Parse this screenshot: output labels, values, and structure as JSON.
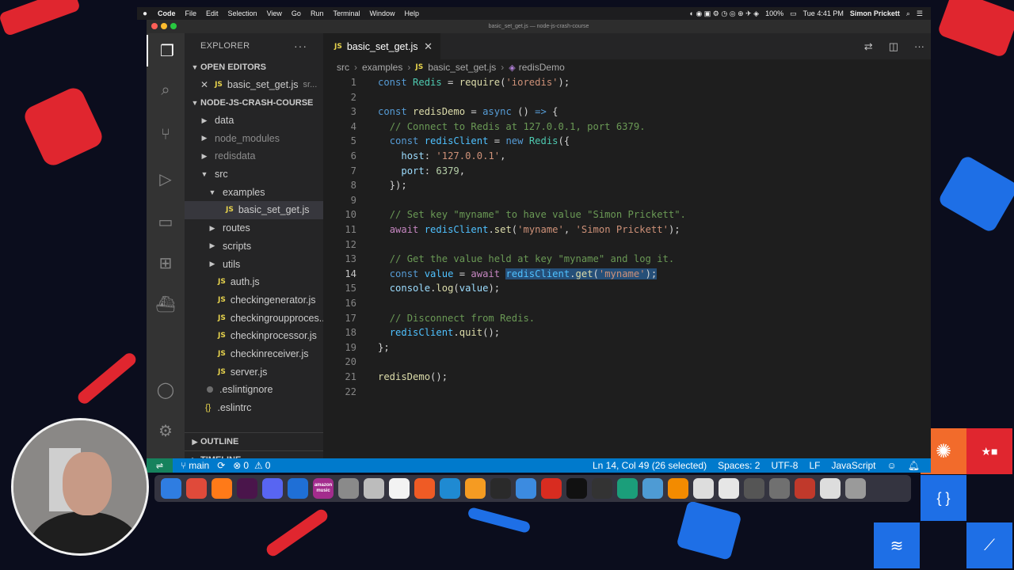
{
  "menubar": {
    "apple": "",
    "items": [
      "Code",
      "File",
      "Edit",
      "Selection",
      "View",
      "Go",
      "Run",
      "Terminal",
      "Window",
      "Help"
    ],
    "battery": "100%",
    "clock": "Tue 4:41 PM",
    "user": "Simon Prickett"
  },
  "window": {
    "title": "basic_set_get.js — node-js-crash-course"
  },
  "sidebar": {
    "title": "EXPLORER",
    "open_editors_label": "OPEN EDITORS",
    "open_editor": {
      "badge": "JS",
      "name": "basic_set_get.js",
      "path": "sr..."
    },
    "project_label": "NODE-JS-CRASH-COURSE",
    "tree": [
      {
        "name": "data",
        "kind": "folder",
        "depth": 1,
        "expanded": false,
        "dim": false
      },
      {
        "name": "node_modules",
        "kind": "folder",
        "depth": 1,
        "expanded": false,
        "dim": true
      },
      {
        "name": "redisdata",
        "kind": "folder",
        "depth": 1,
        "expanded": false,
        "dim": true
      },
      {
        "name": "src",
        "kind": "folder",
        "depth": 1,
        "expanded": true,
        "dim": false
      },
      {
        "name": "examples",
        "kind": "folder",
        "depth": 2,
        "expanded": true,
        "dim": false
      },
      {
        "name": "basic_set_get.js",
        "kind": "js",
        "depth": 3,
        "selected": true
      },
      {
        "name": "routes",
        "kind": "folder",
        "depth": 2,
        "expanded": false
      },
      {
        "name": "scripts",
        "kind": "folder",
        "depth": 2,
        "expanded": false
      },
      {
        "name": "utils",
        "kind": "folder",
        "depth": 2,
        "expanded": false
      },
      {
        "name": "auth.js",
        "kind": "js",
        "depth": 2
      },
      {
        "name": "checkingenerator.js",
        "kind": "js",
        "depth": 2
      },
      {
        "name": "checkingroupproces...",
        "kind": "js",
        "depth": 2
      },
      {
        "name": "checkinprocessor.js",
        "kind": "js",
        "depth": 2
      },
      {
        "name": "checkinreceiver.js",
        "kind": "js",
        "depth": 2
      },
      {
        "name": "server.js",
        "kind": "js",
        "depth": 2
      },
      {
        "name": ".eslintignore",
        "kind": "plain",
        "depth": 1
      },
      {
        "name": ".eslintrc",
        "kind": "json",
        "depth": 1
      }
    ],
    "outline_label": "OUTLINE",
    "timeline_label": "TIMELINE"
  },
  "editor": {
    "tab": {
      "badge": "JS",
      "name": "basic_set_get.js"
    },
    "breadcrumb": [
      "src",
      "examples",
      "basic_set_get.js",
      "redisDemo"
    ],
    "breadcrumb_badge": "JS",
    "active_line": 14,
    "lines": [
      [
        [
          "k",
          "const "
        ],
        [
          "cls",
          "Redis"
        ],
        [
          "p",
          " = "
        ],
        [
          "f",
          "require"
        ],
        [
          "p",
          "("
        ],
        [
          "s",
          "'ioredis'"
        ],
        [
          "p",
          ");"
        ]
      ],
      [],
      [
        [
          "k",
          "const "
        ],
        [
          "f",
          "redisDemo"
        ],
        [
          "p",
          " = "
        ],
        [
          "k",
          "async "
        ],
        [
          "p",
          "() "
        ],
        [
          "k",
          "=>"
        ],
        [
          "p",
          " {"
        ]
      ],
      [
        [
          "p",
          "  "
        ],
        [
          "cm",
          "// Connect to Redis at 127.0.0.1, port 6379."
        ]
      ],
      [
        [
          "p",
          "  "
        ],
        [
          "k",
          "const "
        ],
        [
          "c",
          "redisClient"
        ],
        [
          "p",
          " = "
        ],
        [
          "k",
          "new "
        ],
        [
          "cls",
          "Redis"
        ],
        [
          "p",
          "({"
        ]
      ],
      [
        [
          "p",
          "    "
        ],
        [
          "v",
          "host"
        ],
        [
          "p",
          ": "
        ],
        [
          "s",
          "'127.0.0.1'"
        ],
        [
          "p",
          ","
        ]
      ],
      [
        [
          "p",
          "    "
        ],
        [
          "v",
          "port"
        ],
        [
          "p",
          ": "
        ],
        [
          "n",
          "6379"
        ],
        [
          "p",
          ","
        ]
      ],
      [
        [
          "p",
          "  });"
        ]
      ],
      [],
      [
        [
          "p",
          "  "
        ],
        [
          "cm",
          "// Set key \"myname\" to have value \"Simon Prickett\"."
        ]
      ],
      [
        [
          "p",
          "  "
        ],
        [
          "kw2",
          "await "
        ],
        [
          "c",
          "redisClient"
        ],
        [
          "p",
          "."
        ],
        [
          "f",
          "set"
        ],
        [
          "p",
          "("
        ],
        [
          "s",
          "'myname'"
        ],
        [
          "p",
          ", "
        ],
        [
          "s",
          "'Simon Prickett'"
        ],
        [
          "p",
          ");"
        ]
      ],
      [],
      [
        [
          "p",
          "  "
        ],
        [
          "cm",
          "// Get the value held at key \"myname\" and log it."
        ]
      ],
      [
        [
          "p",
          "  "
        ],
        [
          "k",
          "const "
        ],
        [
          "c",
          "value"
        ],
        [
          "p",
          " = "
        ],
        [
          "kw2",
          "await "
        ],
        [
          "hl-c",
          "redisClient"
        ],
        [
          "hl-p",
          "."
        ],
        [
          "hl-f",
          "get"
        ],
        [
          "hl-p",
          "("
        ],
        [
          "hl-s",
          "'myname'"
        ],
        [
          "hl-p",
          ");"
        ]
      ],
      [
        [
          "p",
          "  "
        ],
        [
          "v",
          "console"
        ],
        [
          "p",
          "."
        ],
        [
          "f",
          "log"
        ],
        [
          "p",
          "("
        ],
        [
          "v",
          "value"
        ],
        [
          "p",
          ");"
        ]
      ],
      [],
      [
        [
          "p",
          "  "
        ],
        [
          "cm",
          "// Disconnect from Redis."
        ]
      ],
      [
        [
          "p",
          "  "
        ],
        [
          "c",
          "redisClient"
        ],
        [
          "p",
          "."
        ],
        [
          "f",
          "quit"
        ],
        [
          "p",
          "();"
        ]
      ],
      [
        [
          "p",
          "};"
        ]
      ],
      [],
      [
        [
          "f",
          "redisDemo"
        ],
        [
          "p",
          "();"
        ]
      ],
      []
    ]
  },
  "statusbar": {
    "branch": "main",
    "errors": "0",
    "warnings": "0",
    "position": "Ln 14, Col 49 (26 selected)",
    "spaces": "Spaces: 2",
    "encoding": "UTF-8",
    "eol": "LF",
    "language": "JavaScript"
  },
  "dock": {
    "apps": [
      {
        "icon": "finder-icon",
        "color": "#2f7de1"
      },
      {
        "icon": "chrome-icon",
        "color": "#e04a3a"
      },
      {
        "icon": "firefox-icon",
        "color": "#ff7a18"
      },
      {
        "icon": "slack-icon",
        "color": "#4a154b"
      },
      {
        "icon": "discord-icon",
        "color": "#5865f2"
      },
      {
        "icon": "browser-icon",
        "color": "#1f6fd6"
      },
      {
        "icon": "music-icon",
        "color": "#a32c8d"
      },
      {
        "icon": "settings-icon",
        "color": "#8a8a8a"
      },
      {
        "icon": "mail-icon",
        "color": "#bcbcbc"
      },
      {
        "icon": "calendar-icon",
        "color": "#f3f3f3"
      },
      {
        "icon": "postman-icon",
        "color": "#ef5b25"
      },
      {
        "icon": "vscode-icon",
        "color": "#1f8ad2"
      },
      {
        "icon": "sublime-icon",
        "color": "#f59b22"
      },
      {
        "icon": "intellij-icon",
        "color": "#2a2a2a"
      },
      {
        "icon": "xcode-icon",
        "color": "#3c8be0"
      },
      {
        "icon": "redis-icon",
        "color": "#d82c20"
      },
      {
        "icon": "terminal-icon",
        "color": "#111111"
      },
      {
        "icon": "github-icon",
        "color": "#333333"
      },
      {
        "icon": "gitkraken-icon",
        "color": "#1b9e7a"
      },
      {
        "icon": "calculator-icon",
        "color": "#4e9bd4"
      },
      {
        "icon": "vlc-icon",
        "color": "#f38b00"
      },
      {
        "icon": "document-icon",
        "color": "#dddddd"
      },
      {
        "icon": "window-icon",
        "color": "#e6e6e6"
      },
      {
        "icon": "window-icon",
        "color": "#555555"
      },
      {
        "icon": "window-icon",
        "color": "#707070"
      },
      {
        "icon": "window-icon",
        "color": "#c0392b"
      },
      {
        "icon": "window-icon",
        "color": "#dddddd"
      },
      {
        "icon": "trash-icon",
        "color": "#9a9a9a"
      }
    ],
    "music_label": "amazon music"
  }
}
